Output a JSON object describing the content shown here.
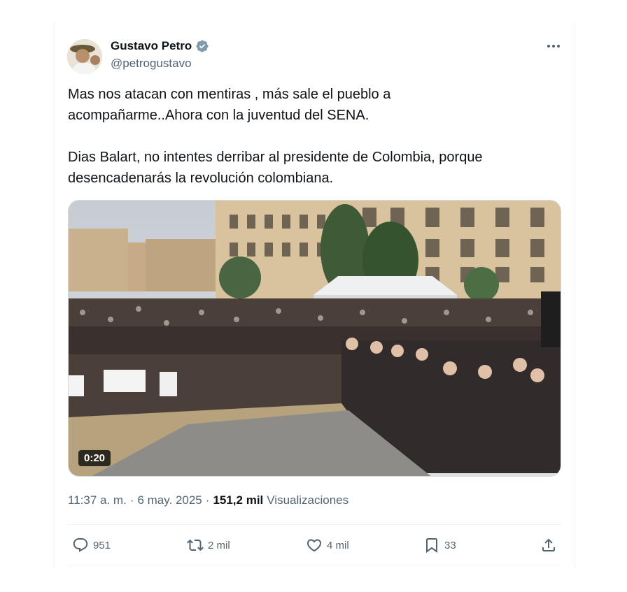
{
  "author": {
    "name": "Gustavo Petro",
    "handle": "@petrogustavo",
    "verified_color": "#829aab"
  },
  "tweet": {
    "text": "Mas nos atacan con mentiras , más sale el pueblo a\nacompañarme..Ahora con la juventud del SENA.\n\nDias Balart, no intentes derribar al presidente de Colombia, porque\ndesencadenarás la revolución colombiana.",
    "video_duration": "0:20",
    "time": "11:37 a. m.",
    "dot1": "·",
    "date": "6 may. 2025",
    "dot2": "·",
    "views_count": "151,2 mil",
    "views_label": "Visualizaciones"
  },
  "actions": {
    "replies": "951",
    "reposts": "2 mil",
    "likes": "4 mil",
    "bookmarks": "33"
  },
  "icons": [
    "verified-badge-icon",
    "more-icon",
    "reply-icon",
    "repost-icon",
    "like-icon",
    "bookmark-icon",
    "share-icon"
  ]
}
